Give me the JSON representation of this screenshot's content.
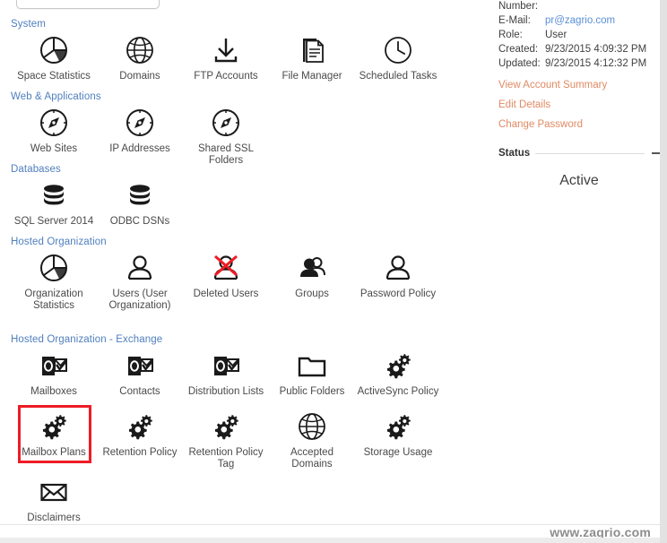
{
  "window": {
    "watermark": "www.zagrio.com"
  },
  "top_control": {
    "name": "search-box-partial"
  },
  "sections": [
    {
      "id": "system",
      "title": "System",
      "items": [
        {
          "label": "Space Statistics",
          "icon": "pie-chart-icon"
        },
        {
          "label": "Domains",
          "icon": "globe-icon"
        },
        {
          "label": "FTP Accounts",
          "icon": "download-arrow-icon"
        },
        {
          "label": "File Manager",
          "icon": "document-icon"
        },
        {
          "label": "Scheduled Tasks",
          "icon": "clock-icon"
        }
      ]
    },
    {
      "id": "web-applications",
      "title": "Web & Applications",
      "items": [
        {
          "label": "Web Sites",
          "icon": "compass-icon"
        },
        {
          "label": "IP Addresses",
          "icon": "compass-icon"
        },
        {
          "label": "Shared SSL Folders",
          "icon": "compass-icon"
        }
      ]
    },
    {
      "id": "databases",
      "title": "Databases",
      "items": [
        {
          "label": "SQL Server 2014",
          "icon": "database-icon"
        },
        {
          "label": "ODBC DSNs",
          "icon": "database-icon"
        }
      ]
    },
    {
      "id": "hosted-organization",
      "title": "Hosted Organization",
      "items": [
        {
          "label": "Organization Statistics",
          "icon": "pie-chart-icon"
        },
        {
          "label": "Users (User Organization)",
          "icon": "user-icon"
        },
        {
          "label": "Deleted Users",
          "icon": "user-deleted-icon"
        },
        {
          "label": "Groups",
          "icon": "users-group-icon"
        },
        {
          "label": "Password Policy",
          "icon": "user-icon"
        }
      ]
    },
    {
      "id": "hosted-organization-exchange",
      "title": "Hosted Organization - Exchange",
      "items": [
        {
          "label": "Mailboxes",
          "icon": "outlook-icon"
        },
        {
          "label": "Contacts",
          "icon": "outlook-icon"
        },
        {
          "label": "Distribution Lists",
          "icon": "outlook-icon"
        },
        {
          "label": "Public Folders",
          "icon": "folder-icon"
        },
        {
          "label": "ActiveSync Policy",
          "icon": "gears-icon"
        },
        {
          "label": "Mailbox Plans",
          "icon": "gears-icon",
          "highlighted": true
        },
        {
          "label": "Retention Policy",
          "icon": "gears-icon"
        },
        {
          "label": "Retention Policy Tag",
          "icon": "gears-icon"
        },
        {
          "label": "Accepted Domains",
          "icon": "globe-icon"
        },
        {
          "label": "Storage Usage",
          "icon": "gears-icon"
        },
        {
          "label": "Disclaimers",
          "icon": "envelope-icon"
        }
      ]
    }
  ],
  "info_panel": {
    "fields": [
      {
        "key": "Number:",
        "value": "",
        "is_link": false
      },
      {
        "key": "E-Mail:",
        "value": "pr@zagrio.com",
        "is_link": true
      },
      {
        "key": "Role:",
        "value": "User",
        "is_link": false
      },
      {
        "key": "Created:",
        "value": "9/23/2015 4:09:32 PM",
        "is_link": false
      },
      {
        "key": "Updated:",
        "value": "9/23/2015 4:12:32 PM",
        "is_link": false
      }
    ],
    "links": [
      {
        "label": "View Account Summary"
      },
      {
        "label": "Edit Details"
      },
      {
        "label": "Change Password"
      }
    ],
    "status": {
      "title": "Status",
      "value": "Active"
    }
  },
  "colors": {
    "section_header": "#4f7fbf",
    "link": "#e08a63",
    "email_link": "#5b8fd6",
    "highlight": "#ee1c25"
  }
}
